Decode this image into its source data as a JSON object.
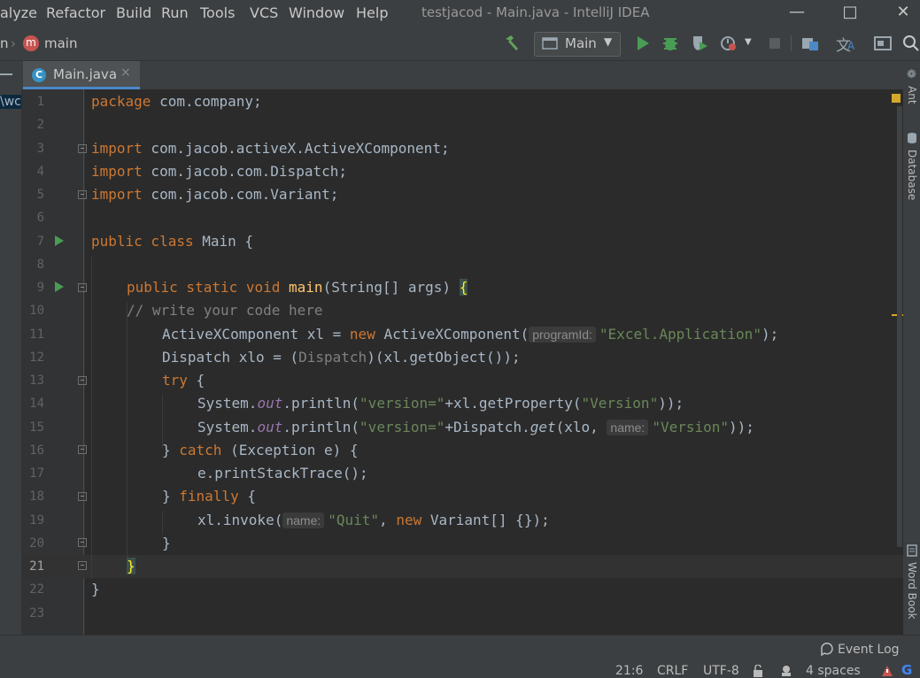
{
  "menu": [
    "alyze",
    "Refactor",
    "Build",
    "Run",
    "Tools",
    "VCS",
    "Window",
    "Help"
  ],
  "window_title": "testjacod - Main.java - IntelliJ IDEA",
  "breadcrumb": {
    "prev": "n",
    "current": "main",
    "badge": "m"
  },
  "run_config": {
    "label": "Main"
  },
  "tab": {
    "label": "Main.java",
    "close": "×",
    "icon_letter": "C"
  },
  "left_strip_text": "\\wc",
  "right_tools": [
    "Ant",
    "Database",
    "Word Book"
  ],
  "line_numbers": [
    "1",
    "2",
    "3",
    "4",
    "5",
    "6",
    "7",
    "8",
    "9",
    "10",
    "11",
    "12",
    "13",
    "14",
    "15",
    "16",
    "17",
    "18",
    "19",
    "20",
    "21",
    "22",
    "23"
  ],
  "code": {
    "l1": [
      "package",
      " com.company;"
    ],
    "l3": [
      "import",
      " com.jacob.activeX.ActiveXComponent;"
    ],
    "l4": [
      "import",
      " com.jacob.com.Dispatch;"
    ],
    "l5": [
      "import",
      " com.jacob.com.Variant;"
    ],
    "l7": [
      "public class",
      " Main {"
    ],
    "l9": [
      "public static void",
      " ",
      "main",
      "(String[] args) ",
      "{"
    ],
    "l10": "// write your code here",
    "l11": [
      "ActiveXComponent xl = ",
      "new",
      " ActiveXComponent(",
      "programId:",
      "\"Excel.Application\"",
      ");"
    ],
    "l12": [
      "Dispatch xlo = (",
      "Dispatch",
      ")(xl.getObject());"
    ],
    "l13": [
      "try",
      " {"
    ],
    "l14": [
      "System.",
      "out",
      ".println(",
      "\"version=\"",
      "+xl.getProperty(",
      "\"Version\"",
      "));"
    ],
    "l15": [
      "System.",
      "out",
      ".println(",
      "\"version=\"",
      "+Dispatch.",
      "get",
      "(xlo, ",
      "name:",
      "\"Version\"",
      "));"
    ],
    "l16": [
      "} ",
      "catch",
      " (Exception e) {"
    ],
    "l17": "e.printStackTrace();",
    "l18": [
      "} ",
      "finally",
      " {"
    ],
    "l19": [
      "xl.invoke(",
      "name:",
      "\"Quit\"",
      ", ",
      "new",
      " Variant[] {});"
    ],
    "l20": "}",
    "l21": "}",
    "l22": "}"
  },
  "status": {
    "event_log": "Event Log",
    "position": "21:6",
    "line_sep": "CRLF",
    "encoding": "UTF-8",
    "indent": "4 spaces"
  },
  "colors": {
    "keyword": "#cc7832",
    "string": "#6a8759",
    "comment": "#808080",
    "run_green": "#499c54",
    "accent": "#4a88c7"
  }
}
